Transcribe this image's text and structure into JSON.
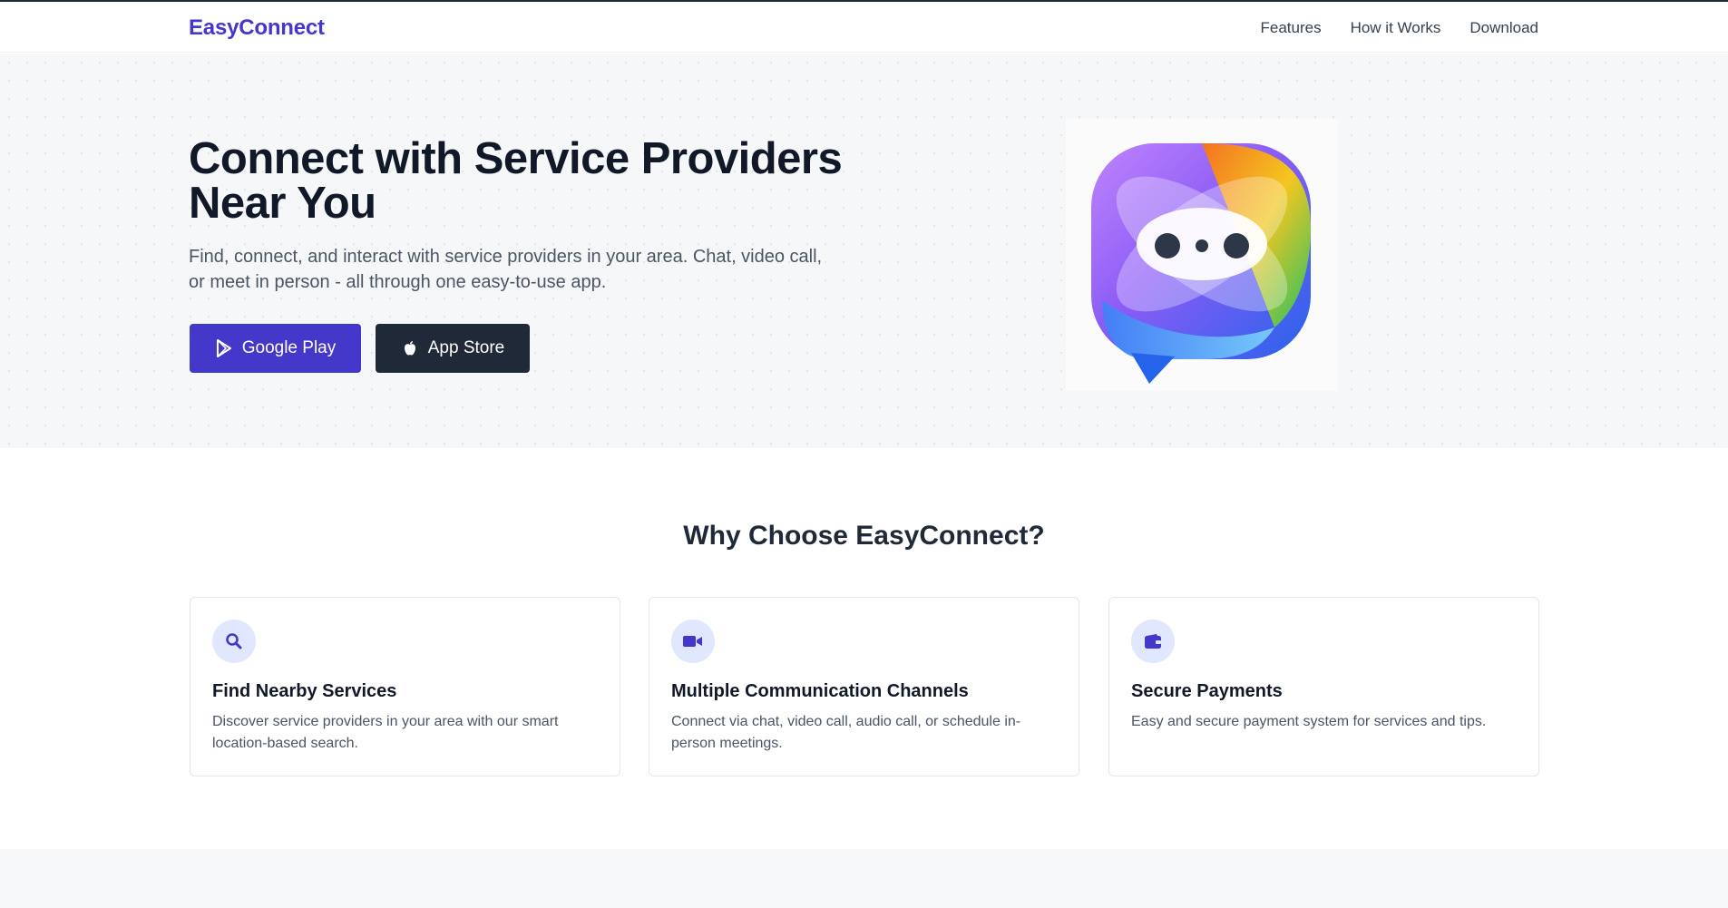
{
  "nav": {
    "brand": "EasyConnect",
    "links": [
      "Features",
      "How it Works",
      "Download"
    ]
  },
  "hero": {
    "title": "Connect with Service Providers Near You",
    "subtitle": "Find, connect, and interact with service providers in your area. Chat, video call, or meet in person - all through one easy-to-use app.",
    "buttons": [
      {
        "label": "Google Play",
        "icon": "google-play-icon"
      },
      {
        "label": "App Store",
        "icon": "apple-icon"
      }
    ]
  },
  "features": {
    "title": "Why Choose EasyConnect?",
    "cards": [
      {
        "icon": "search-icon",
        "title": "Find Nearby Services",
        "text": "Discover service providers in your area with our smart location-based search."
      },
      {
        "icon": "video-camera-icon",
        "title": "Multiple Communication Channels",
        "text": "Connect via chat, video call, audio call, or schedule in-person meetings."
      },
      {
        "icon": "wallet-icon",
        "title": "Secure Payments",
        "text": "Easy and secure payment system for services and tips."
      }
    ]
  },
  "colors": {
    "brand": "#4338ca",
    "dark_button": "#1f2937",
    "icon_bg": "#e0e7ff"
  }
}
